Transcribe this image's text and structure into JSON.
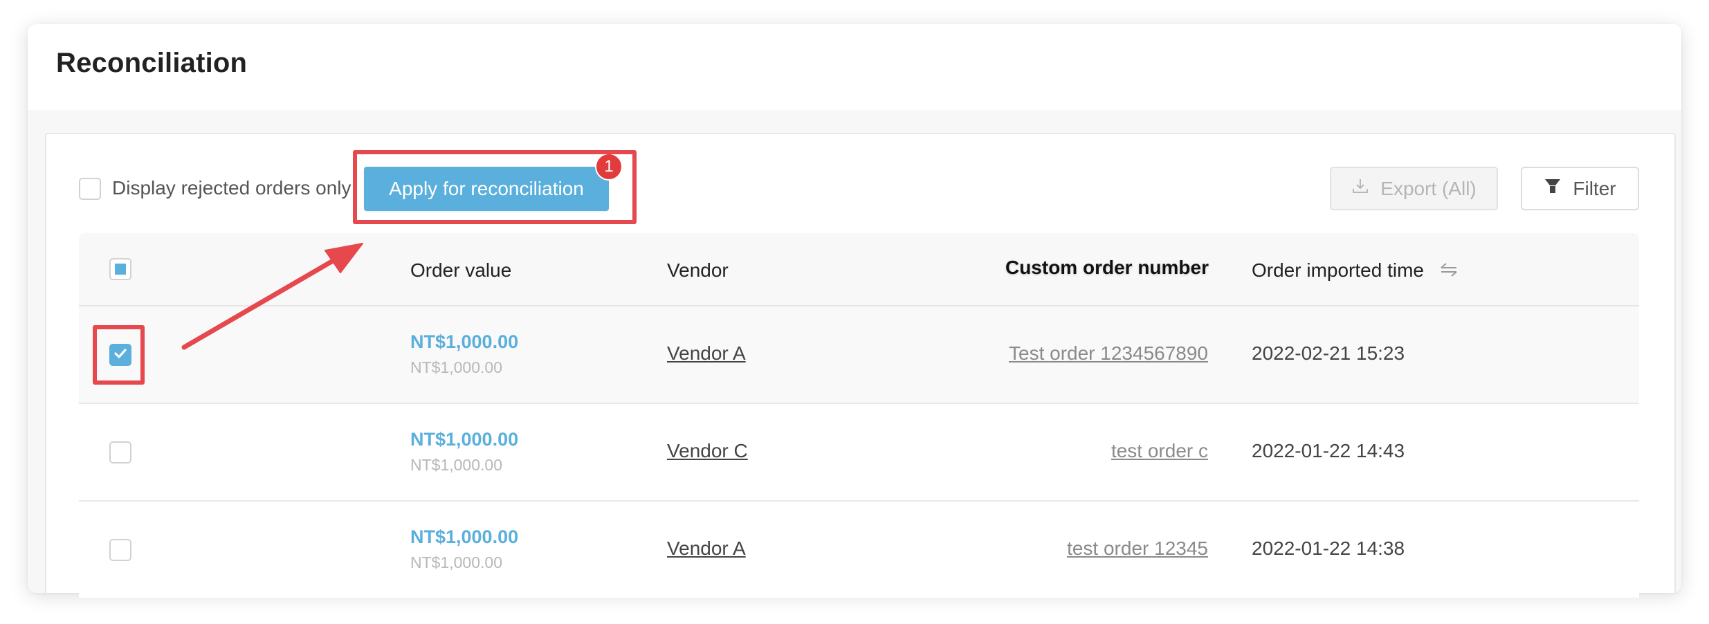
{
  "header": {
    "title": "Reconciliation"
  },
  "toolbar": {
    "rejected_only_label": "Display rejected orders only",
    "rejected_only_checked": false,
    "apply_label": "Apply for reconciliation",
    "apply_badge": "1",
    "export_label": "Export (All)",
    "export_icon": "download-icon",
    "filter_label": "Filter",
    "filter_icon": "funnel-icon"
  },
  "table": {
    "columns": {
      "order_value": "Order value",
      "vendor": "Vendor",
      "custom_order_number": "Custom order number",
      "order_imported_time": "Order imported time"
    },
    "sort_icon": "sort-icon",
    "select_all_state": "indeterminate",
    "rows": [
      {
        "selected": true,
        "order_value": "NT$1,000.00",
        "order_value_secondary": "NT$1,000.00",
        "vendor": "Vendor A",
        "custom_order_number": "Test order 1234567890",
        "order_imported_time": "2022-02-21 15:23"
      },
      {
        "selected": false,
        "order_value": "NT$1,000.00",
        "order_value_secondary": "NT$1,000.00",
        "vendor": "Vendor C",
        "custom_order_number": "test order c",
        "order_imported_time": "2022-01-22 14:43"
      },
      {
        "selected": false,
        "order_value": "NT$1,000.00",
        "order_value_secondary": "NT$1,000.00",
        "vendor": "Vendor A",
        "custom_order_number": "test order 12345",
        "order_imported_time": "2022-01-22 14:38"
      }
    ]
  },
  "annotations": {
    "color": "#e5484d",
    "arrow_from": "selected-row-checkbox",
    "arrow_to": "apply-for-reconciliation-button"
  },
  "colors": {
    "accent": "#5aafdc",
    "badge": "#e23b3b"
  }
}
